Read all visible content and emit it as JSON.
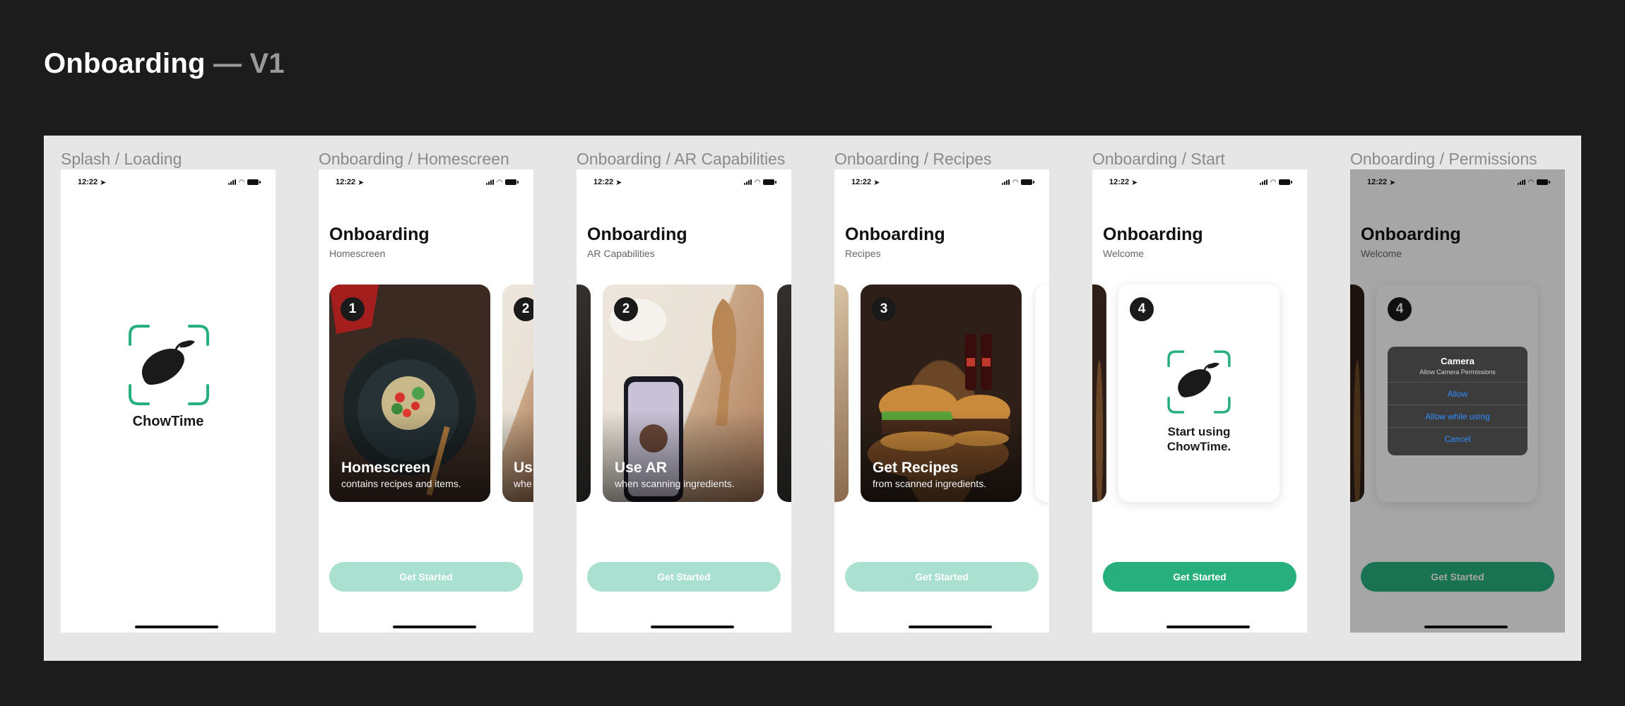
{
  "header": {
    "title": "Onboarding",
    "separator": "—",
    "version": "V1"
  },
  "status_time": "12:22",
  "frames": [
    {
      "label": "Splash / Loading"
    },
    {
      "label": "Onboarding / Homescreen"
    },
    {
      "label": "Onboarding / AR Capabilities"
    },
    {
      "label": "Onboarding / Recipes"
    },
    {
      "label": "Onboarding / Start"
    },
    {
      "label": "Onboarding / Permissions"
    }
  ],
  "splash": {
    "app_name": "ChowTime"
  },
  "screens": {
    "homescreen": {
      "title": "Onboarding",
      "subtitle": "Homescreen",
      "card_number": "1",
      "card_title": "Homescreen",
      "card_desc": "contains recipes and items.",
      "peek_number": "2",
      "peek_title": "Us",
      "peek_desc": "whe",
      "cta": "Get Started"
    },
    "ar": {
      "title": "Onboarding",
      "subtitle": "AR Capabilities",
      "card_number": "2",
      "card_title": "Use AR",
      "card_desc": "when scanning ingredients.",
      "cta": "Get Started"
    },
    "recipes": {
      "title": "Onboarding",
      "subtitle": "Recipes",
      "card_number": "3",
      "card_title": "Get Recipes",
      "card_desc": "from scanned ingredients.",
      "cta": "Get Started"
    },
    "start": {
      "title": "Onboarding",
      "subtitle": "Welcome",
      "card_number": "4",
      "card_text_1": "Start using",
      "card_text_2": "ChowTime.",
      "cta": "Get Started"
    },
    "permissions": {
      "title": "Onboarding",
      "subtitle": "Welcome",
      "card_number": "4",
      "cta": "Get Started",
      "dialog": {
        "title": "Camera",
        "message": "Allow Camera Permissions",
        "buttons": [
          "Allow",
          "Allow while using",
          "Cancel"
        ]
      }
    }
  },
  "colors": {
    "accent": "#27b07e",
    "accent_disabled": "#a9e0cf",
    "dialog_link": "#2f8cff"
  }
}
